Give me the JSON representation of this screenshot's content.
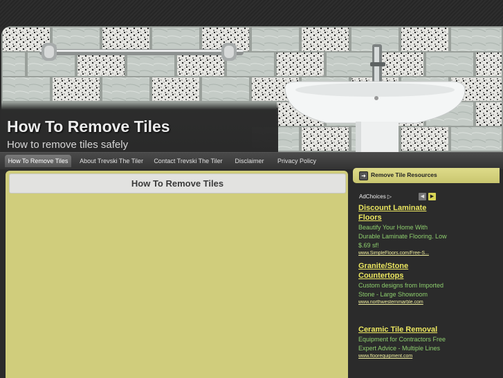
{
  "site": {
    "title": "How To Remove Tiles",
    "tagline": "How to remove tiles safely"
  },
  "nav": {
    "items": [
      {
        "label": "How To Remove Tiles",
        "active": true
      },
      {
        "label": "About Trevski The Tiler",
        "active": false
      },
      {
        "label": "Contact Trevski The Tiler",
        "active": false
      },
      {
        "label": "Disclaimer",
        "active": false
      },
      {
        "label": "Privacy Policy",
        "active": false
      }
    ]
  },
  "main": {
    "title": "How To Remove Tiles"
  },
  "sidebar": {
    "title": "Remove Tile Resources",
    "adchoices_label": "AdChoices",
    "ads": [
      {
        "title": "Discount Laminate Floors",
        "desc": "Beautify Your Home With Durable Laminate Flooring. Low $.69 sf!",
        "url": "www.SimpleFloors.com/Free-S..."
      },
      {
        "title": "Granite/Stone Countertops",
        "desc": "Custom designs from Imported Stone - Large Showroom",
        "url": "www.northwesternmarble.com"
      },
      {
        "title": "Ceramic Tile Removal",
        "desc": "Equipment for Contractors Free Expert Advice - Multiple Lines",
        "url": "www.floorequipment.com"
      }
    ]
  },
  "colors": {
    "content_bg": "#d0cd7c",
    "accent_yellow": "#ece760",
    "ad_text_green": "#8ecf6e",
    "dark_bg": "#2b2b2b"
  }
}
